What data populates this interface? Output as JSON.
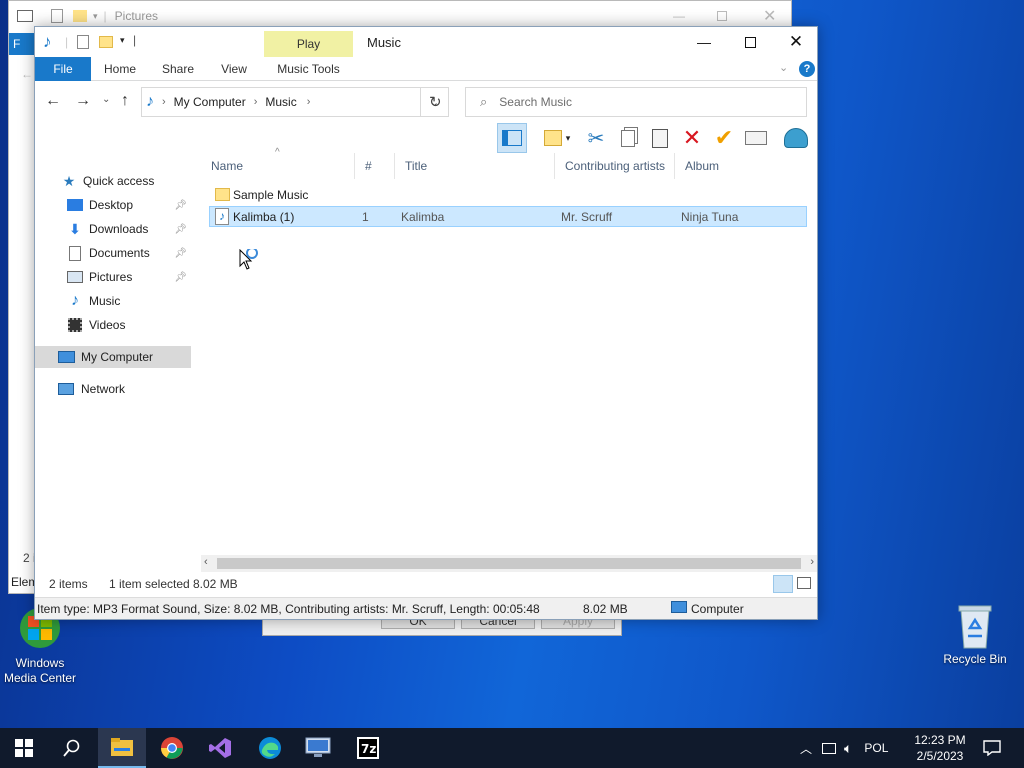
{
  "desktop": {
    "icons": [
      {
        "label": "Windows Media Center"
      },
      {
        "label": "Recycle Bin"
      }
    ]
  },
  "background_window": {
    "title": "Pictures",
    "tab_letter": "F",
    "partial_left_texts": [
      "2 i",
      "Elem"
    ]
  },
  "back_dialog": {
    "ok": "OK",
    "cancel": "Cancel",
    "apply": "Apply"
  },
  "window": {
    "title": "Music",
    "context_tab_group": "Play",
    "ribbon_tabs": [
      "File",
      "Home",
      "Share",
      "View",
      "Music Tools"
    ],
    "breadcrumb": [
      "My Computer",
      "Music"
    ],
    "search_placeholder": "Search Music"
  },
  "nav_pane": {
    "quick_access": "Quick access",
    "items": [
      {
        "label": "Desktop",
        "pinned": true
      },
      {
        "label": "Downloads",
        "pinned": true
      },
      {
        "label": "Documents",
        "pinned": true
      },
      {
        "label": "Pictures",
        "pinned": true
      },
      {
        "label": "Music",
        "pinned": false
      },
      {
        "label": "Videos",
        "pinned": false
      }
    ],
    "my_computer": "My Computer",
    "network": "Network"
  },
  "file_list": {
    "columns": [
      "Name",
      "#",
      "Title",
      "Contributing artists",
      "Album"
    ],
    "rows": [
      {
        "name": "Sample Music",
        "num": "",
        "title": "",
        "artists": "",
        "album": "",
        "type": "folder",
        "selected": false
      },
      {
        "name": "Kalimba (1)",
        "num": "1",
        "title": "Kalimba",
        "artists": "Mr. Scruff",
        "album": "Ninja Tuna",
        "type": "audio",
        "selected": true
      }
    ]
  },
  "status": {
    "item_count": "2 items",
    "selection": "1 item selected",
    "size": "8.02 MB"
  },
  "details_bar": {
    "info": "Item type: MP3 Format Sound, Size: 8.02 MB, Contributing artists: Mr. Scruff, Length: 00:05:48",
    "size": "8.02 MB",
    "location": "Computer"
  },
  "taskbar": {
    "apps": [
      "start",
      "search",
      "file-explorer",
      "chrome",
      "visual-studio",
      "edge",
      "remote-desktop",
      "7zip"
    ],
    "tray": {
      "language": "POL",
      "time": "12:23 PM",
      "date": "2/5/2023"
    }
  },
  "colors": {
    "accent": "#1979ca",
    "selection": "#cce8ff",
    "context_tab": "#f1f1a4"
  }
}
